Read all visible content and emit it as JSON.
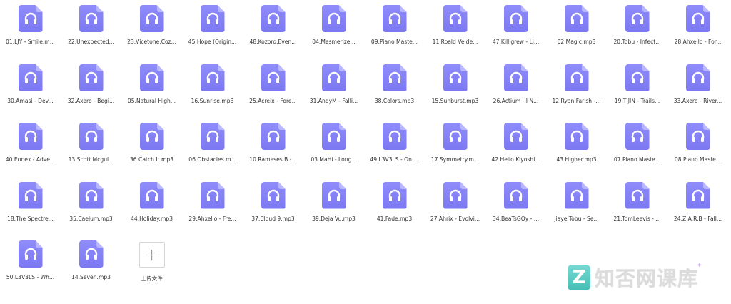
{
  "files": [
    "01.LJY - Smile.m...",
    "22.Unexpected...",
    "23.Vicetone,Coz...",
    "45.Hope (Origin...",
    "48.Kozoro,Even...",
    "04.Mesmerize...",
    "09.Piano Maste...",
    "11.Roald Velde...",
    "47.Killigrew - Li...",
    "02.Magic.mp3",
    "20.Tobu - Infect...",
    "28.Ahxello - For...",
    "30.Amasi - Dev...",
    "32.Axero - Begi...",
    "05.Natural High...",
    "16.Sunrise.mp3",
    "25.Acreix - Fore...",
    "31.AndyM - Falli...",
    "38.Colors.mp3",
    "15.Sunburst.mp3",
    "26.Actium - I N...",
    "12.Ryan Farish -...",
    "19.TIJIN - Trails...",
    "33.Axero - River...",
    "40.Ennex - Adve...",
    "13.Scott Mcgui...",
    "36.Catch It.mp3",
    "06.Obstacles.m...",
    "10.Rameses B -...",
    "03.MaHi - Long...",
    "49.L3V3LS - On ...",
    "17.Symmetry.m...",
    "42.Helio Kiyoshi...",
    "43.Higher.mp3",
    "07.Piano Maste...",
    "08.Piano Maste...",
    "18.The Spectre...",
    "35.Caelum.mp3",
    "44.Holiday.mp3",
    "29.Ahxello - Fre...",
    "37.Cloud 9.mp3",
    "39.Deja Vu.mp3",
    "41.Fade.mp3",
    "27.Ahrix - Evolvi...",
    "34.BeaTsGOy - ...",
    "Jiaye,Tobu - Se...",
    "21.TomLeevis - ...",
    "24.Z.A.R.B - Fall...",
    "50.L3V3LS - Wh...",
    "14.Seven.mp3"
  ],
  "upload": {
    "label": "上传文件",
    "icon": "plus-icon"
  },
  "watermark": {
    "badge": "Z",
    "text": "知否网课库"
  },
  "colors": {
    "icon_fill": "#7c78f2",
    "icon_fold": "#b9b7ff",
    "watermark": "#31b7ad"
  }
}
